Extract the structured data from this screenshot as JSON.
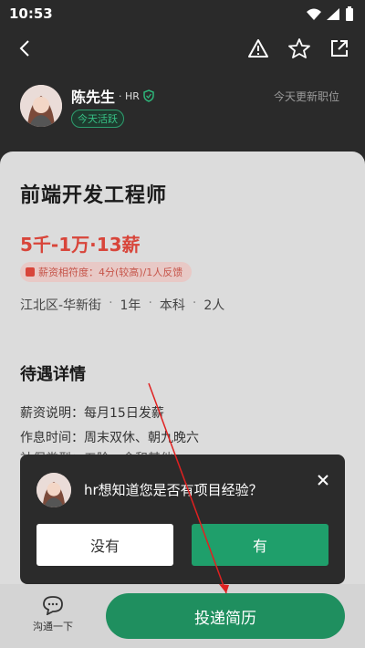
{
  "status_bar": {
    "time": "10:53"
  },
  "nav": {
    "icons": [
      "back-icon",
      "warning-icon",
      "star-icon",
      "share-icon"
    ]
  },
  "recruiter": {
    "name": "陈先生",
    "role": "· HR",
    "active_badge": "今天活跃",
    "update_text": "今天更新职位"
  },
  "job": {
    "title": "前端开发工程师",
    "salary": "5千-1万·13薪",
    "fit_text": "薪资相符度：4分(较高)/1人反馈",
    "meta": [
      "江北区-华新街",
      "1年",
      "本科",
      "2人"
    ],
    "meta_sep": "·"
  },
  "benefits": {
    "title": "待遇详情",
    "rows": [
      "薪资说明：每月15日发薪",
      "作息时间：周末双休、朝九晚六",
      "社保类型：五险一金和其他"
    ]
  },
  "dialog": {
    "question": "hr想知道您是否有项目经验？",
    "no_label": "没有",
    "yes_label": "有"
  },
  "bottom": {
    "chat_label": "沟通一下",
    "apply_label": "投递简历"
  },
  "colors": {
    "accent_green": "#1f8f5f",
    "salary_red": "#d8453a",
    "annotation_red": "#e02020"
  }
}
